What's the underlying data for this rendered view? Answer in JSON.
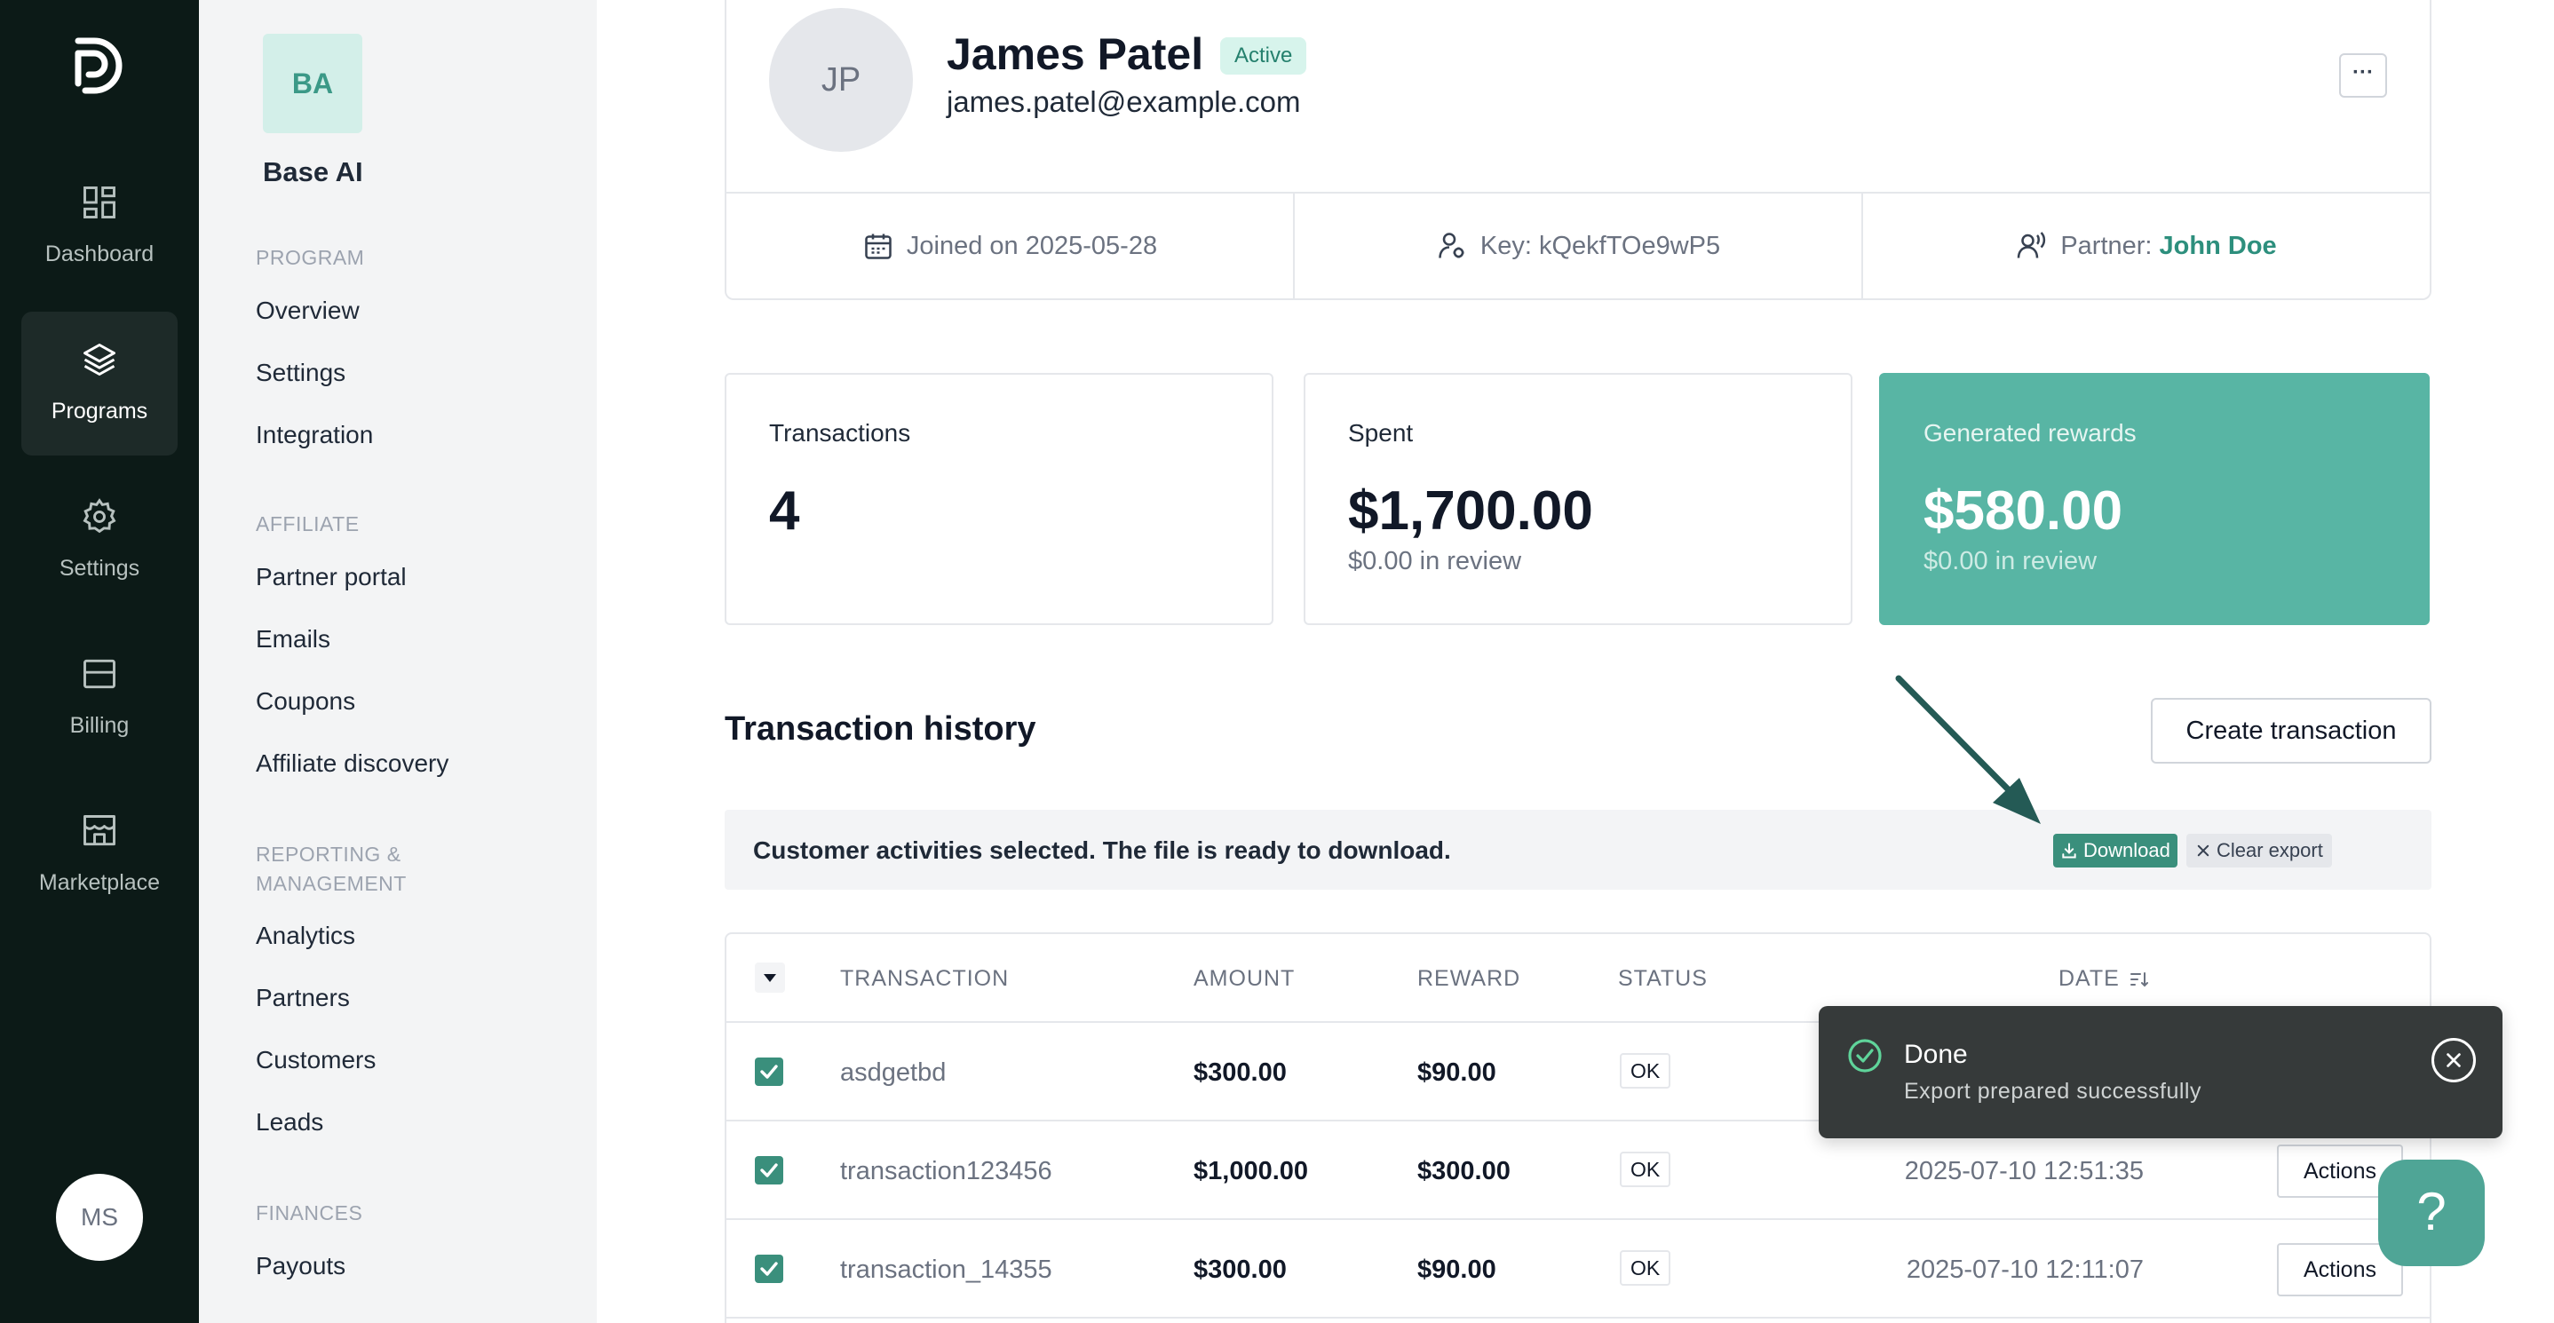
{
  "rail": {
    "items": [
      {
        "label": "Dashboard",
        "icon": "dashboard-icon"
      },
      {
        "label": "Programs",
        "icon": "layers-icon",
        "active": true
      },
      {
        "label": "Settings",
        "icon": "gear-icon"
      },
      {
        "label": "Billing",
        "icon": "billing-icon"
      },
      {
        "label": "Marketplace",
        "icon": "store-icon"
      }
    ],
    "user_initials": "MS"
  },
  "org": {
    "initials": "BA",
    "name": "Base AI"
  },
  "nav": {
    "program_title": "PROGRAM",
    "program": [
      "Overview",
      "Settings",
      "Integration"
    ],
    "affiliate_title": "AFFILIATE",
    "affiliate": [
      "Partner portal",
      "Emails",
      "Coupons",
      "Affiliate discovery"
    ],
    "reporting_title": "REPORTING & MANAGEMENT",
    "reporting": [
      "Analytics",
      "Partners",
      "Customers",
      "Leads"
    ],
    "finances_title": "FINANCES",
    "finances": [
      "Payouts"
    ]
  },
  "profile": {
    "initials": "JP",
    "name": "James Patel",
    "status": "Active",
    "email": "james.patel@example.com",
    "more_label": "···",
    "joined": "Joined on 2025-05-28",
    "key": "Key: kQekfTOe9wP5",
    "partner_prefix": "Partner: ",
    "partner_name": "John Doe"
  },
  "stats": {
    "transactions": {
      "label": "Transactions",
      "value": "4"
    },
    "spent": {
      "label": "Spent",
      "value": "$1,700.00",
      "sub": "$0.00 in review"
    },
    "rewards": {
      "label": "Generated rewards",
      "value": "$580.00",
      "sub": "$0.00 in review"
    }
  },
  "history": {
    "title": "Transaction history",
    "create_label": "Create transaction",
    "export_message": "Customer activities selected. The file is ready to download.",
    "download_label": "Download",
    "clear_label": "Clear export"
  },
  "table": {
    "columns": {
      "transaction": "TRANSACTION",
      "amount": "AMOUNT",
      "reward": "REWARD",
      "status": "STATUS",
      "date": "DATE"
    },
    "rows": [
      {
        "id": "asdgetbd",
        "amount": "$300.00",
        "reward": "$90.00",
        "status": "OK",
        "date": "",
        "action": ""
      },
      {
        "id": "transaction123456",
        "amount": "$1,000.00",
        "reward": "$300.00",
        "status": "OK",
        "date": "2025-07-10 12:51:35",
        "action": "Actions"
      },
      {
        "id": "transaction_14355",
        "amount": "$300.00",
        "reward": "$90.00",
        "status": "OK",
        "date": "2025-07-10 12:11:07",
        "action": "Actions"
      }
    ]
  },
  "toast": {
    "title": "Done",
    "message": "Export prepared successfully"
  },
  "help": {
    "label": "?"
  },
  "colors": {
    "accent": "#58b5a4",
    "accent_dark": "#3a8f7c",
    "rail_bg": "#0c1a17",
    "toast_bg": "#363a3a"
  }
}
